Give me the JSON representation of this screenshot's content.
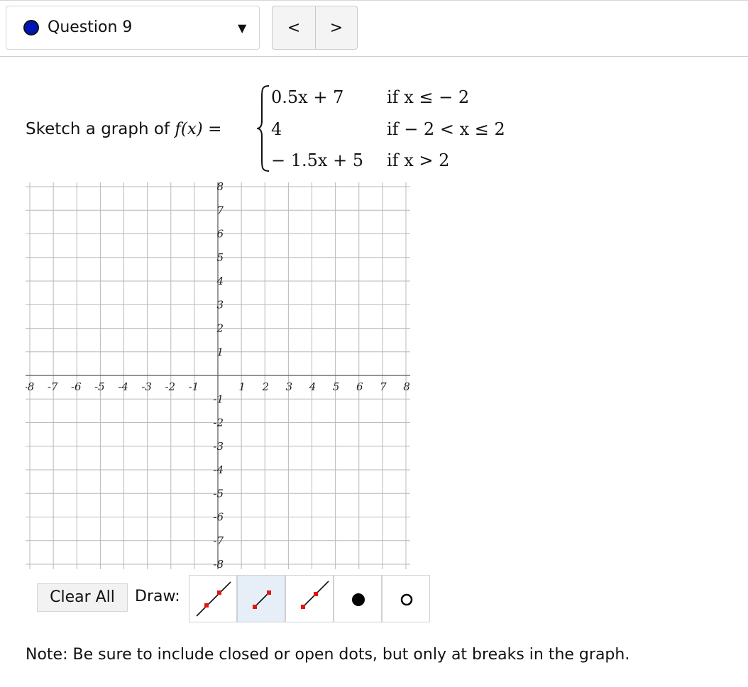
{
  "header": {
    "question_label": "Question 9",
    "status_color": "#0015b5",
    "caret": "▼",
    "prev_label": "<",
    "next_label": ">"
  },
  "problem": {
    "prompt_text": "Sketch a graph of",
    "function_name": "f(x) =",
    "cases": [
      {
        "expr": "0.5x + 7",
        "cond": "if  x ≤ − 2"
      },
      {
        "expr": "4",
        "cond": "if  − 2 < x ≤ 2"
      },
      {
        "expr": "− 1.5x + 5",
        "cond": "if  x > 2"
      }
    ]
  },
  "graph": {
    "x_range": [
      -8,
      8
    ],
    "y_range": [
      -8,
      8
    ],
    "grid": true,
    "x_ticks": [
      "-8",
      "-7",
      "-6",
      "-5",
      "-4",
      "-3",
      "-2",
      "-1",
      "1",
      "2",
      "3",
      "4",
      "5",
      "6",
      "7",
      "8"
    ],
    "y_ticks": [
      "8",
      "7",
      "6",
      "5",
      "4",
      "3",
      "2",
      "1",
      "-1",
      "-2",
      "-3",
      "-4",
      "-5",
      "-6",
      "-7",
      "-8"
    ]
  },
  "toolbar": {
    "clear_label": "Clear All",
    "draw_label": "Draw:",
    "tools": [
      {
        "icon": "line-tool-icon",
        "selected": false
      },
      {
        "icon": "segment-tool-icon",
        "selected": true
      },
      {
        "icon": "ray-tool-icon",
        "selected": false
      },
      {
        "icon": "closed-dot-icon",
        "selected": false
      },
      {
        "icon": "open-dot-icon",
        "selected": false
      }
    ]
  },
  "note": "Note: Be sure to include closed or open dots, but only at breaks in the graph."
}
